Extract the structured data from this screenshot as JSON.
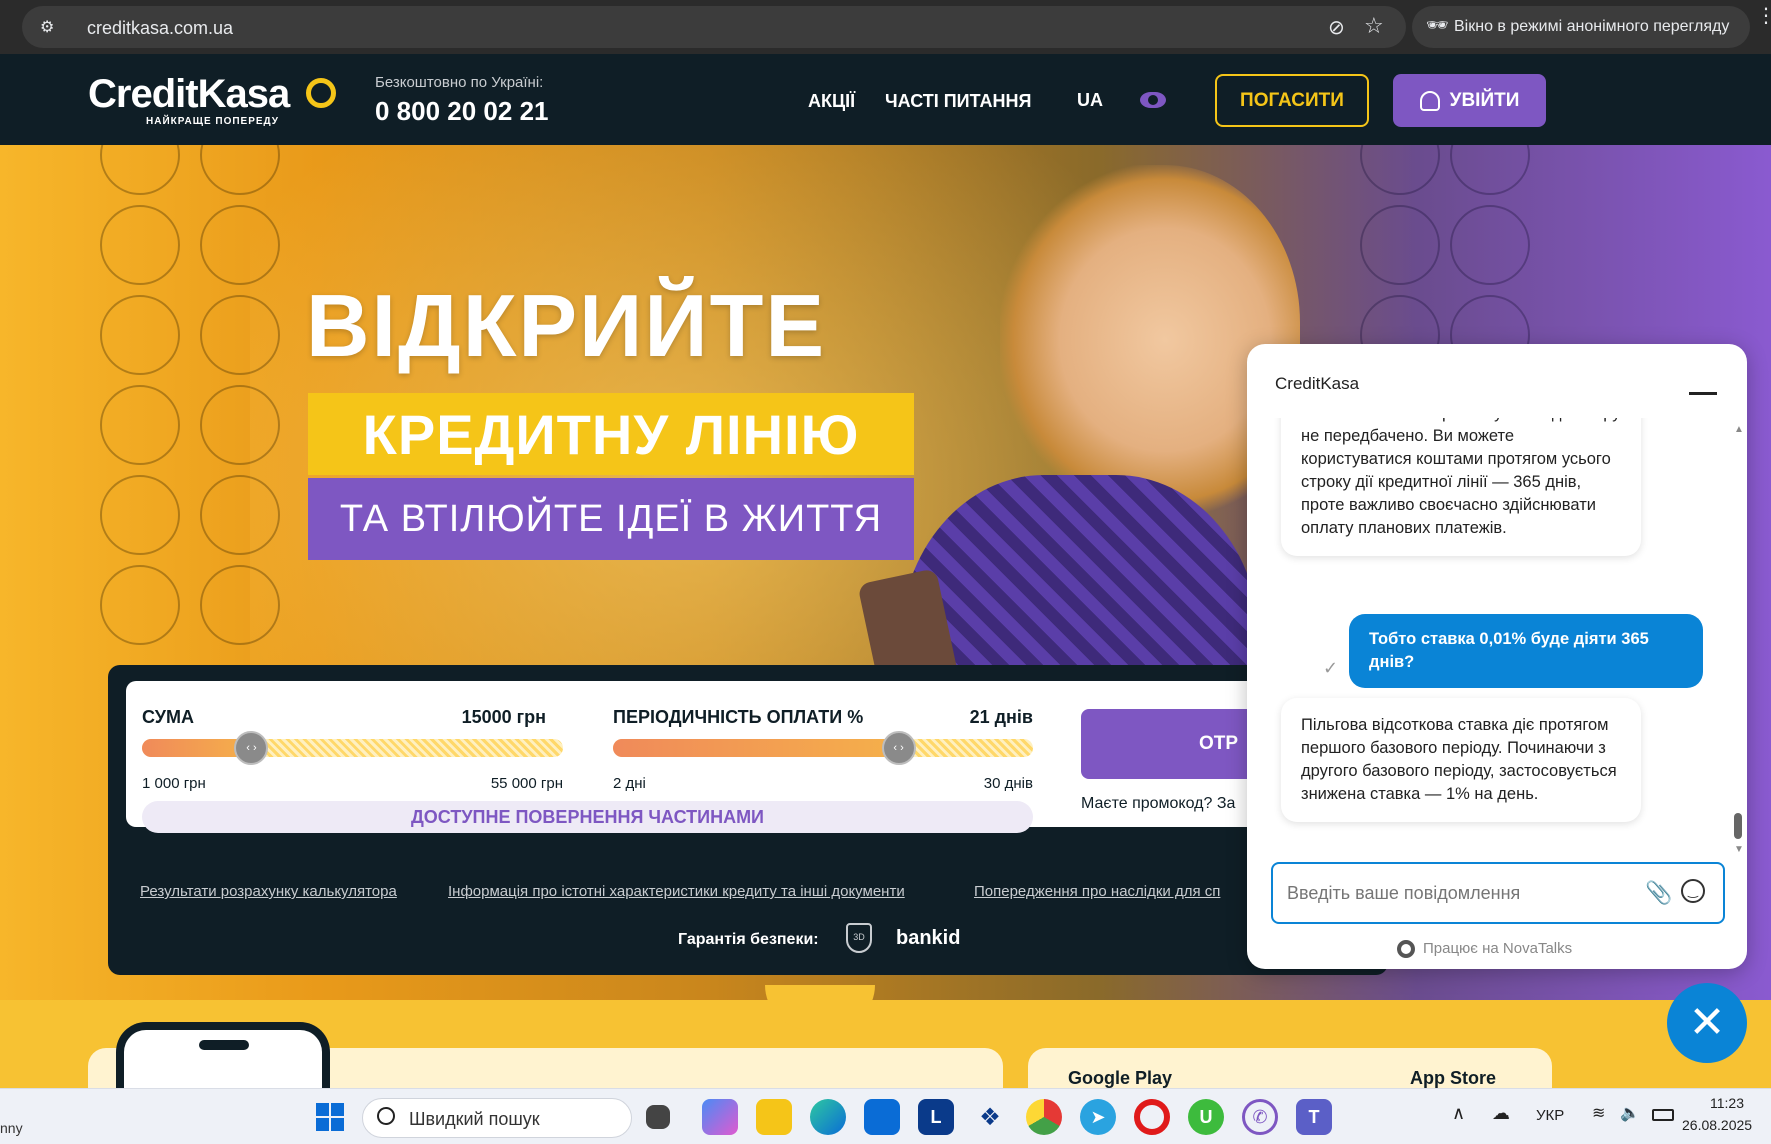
{
  "browser": {
    "url": "creditkasa.com.ua",
    "incognito_label": "Вікно в режимі анонімного перегляду"
  },
  "header": {
    "logo_main": "CreditKasa",
    "logo_tagline": "НАЙКРАЩЕ ПОПЕРЕДУ",
    "phone_caption": "Безкоштовно по Україні:",
    "phone": "0 800 20 02 21",
    "nav": {
      "promo": "АКЦІЇ",
      "faq": "ЧАСТІ ПИТАННЯ",
      "lang": "UA"
    },
    "repay_button": "ПОГАСИТИ",
    "login_button": "УВІЙТИ",
    "colors": {
      "accent_yellow": "#f5c518",
      "accent_purple": "#7e57c2",
      "header_bg": "#0f1e26"
    }
  },
  "hero": {
    "line1": "ВІДКРИЙТЕ",
    "line2": "КРЕДИТНУ ЛІНІЮ",
    "line3": "ТА ВТІЛЮЙТЕ ІДЕЇ В ЖИТТЯ"
  },
  "calculator": {
    "amount_label": "СУМА",
    "amount_value": "15000 грн",
    "amount_min": "1 000 грн",
    "amount_max": "55 000 грн",
    "amount_fraction": 0.26,
    "period_label": "ПЕРІОДИЧНІСТЬ ОПЛАТИ %",
    "period_value": "21 днів",
    "period_min": "2 дні",
    "period_max": "30 днів",
    "period_fraction": 0.68,
    "installments_label": "ДОСТУПНЕ ПОВЕРНЕННЯ ЧАСТИНАМИ",
    "submit_button": "ОТР",
    "promo_prompt": "Маєте промокод? За",
    "links": [
      "Результати розрахунку калькулятора",
      "Інформація про істотні характеристики кредиту та інші документи",
      "Попередження про наслідки для сп"
    ],
    "security_label": "Гарантія безпеки:",
    "badge_3d": "3D",
    "bankid_label": "bankid"
  },
  "chat": {
    "title": "CreditKasa",
    "messages": [
      {
        "from": "operator",
        "text": "У нашій компанії пролонгування договору не передбачено. Ви можете користуватися коштами протягом усього строку дії кредитної лінії — 365 днів, проте важливо своєчасно здійснювати оплату планових платежів."
      },
      {
        "from": "user",
        "text": "Тобто ставка 0,01% буде діяти 365 днів?"
      },
      {
        "from": "operator",
        "text": "Пільгова відсоткова ставка діє протягом першого базового періоду. Починаючи з другого базового періоду, застосовується знижена ставка — 1% на день."
      }
    ],
    "input_placeholder": "Введіть ваше повідомлення",
    "powered_by": "Працює на NovaTalks"
  },
  "bottom": {
    "google_play": "Google Play",
    "app_store": "App Store"
  },
  "taskbar": {
    "left_text": "nny",
    "search_placeholder": "Швидкий пошук",
    "lang": "УКР",
    "time": "11:23",
    "date": "26.08.2025"
  }
}
